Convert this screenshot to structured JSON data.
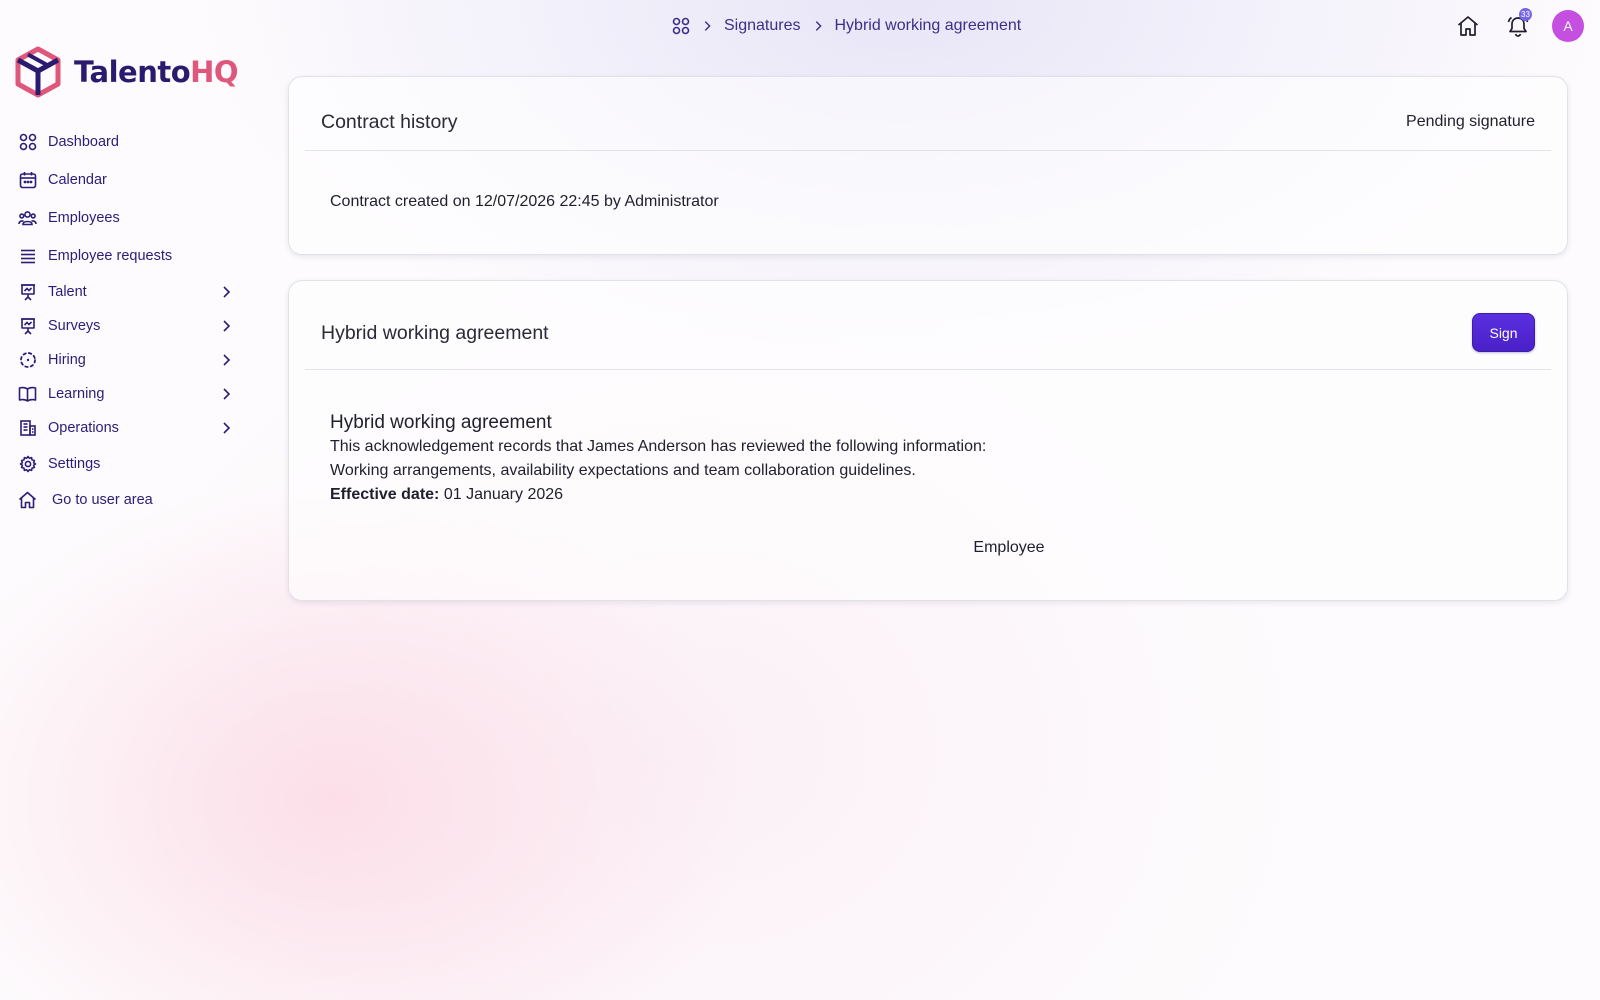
{
  "app": {
    "logo_part1": "Talento",
    "logo_part2": "HQ",
    "brand_colors": {
      "primary": "#2a1b6e",
      "accent": "#e0577c",
      "button": "#4f25d4"
    }
  },
  "breadcrumb": {
    "home_icon": "grid-icon",
    "items": [
      "Signatures",
      "Hybrid working agreement"
    ]
  },
  "topbar": {
    "notifications_count": "33",
    "avatar_initial": "A"
  },
  "sidebar": {
    "items": [
      {
        "label": "Dashboard",
        "icon": "grid-icon",
        "expandable": false
      },
      {
        "label": "Calendar",
        "icon": "calendar-icon",
        "expandable": false
      },
      {
        "label": "Employees",
        "icon": "users-icon",
        "expandable": false
      },
      {
        "label": "Employee requests",
        "icon": "list-icon",
        "expandable": false
      },
      {
        "label": "Talent",
        "icon": "presentation-icon",
        "expandable": true
      },
      {
        "label": "Surveys",
        "icon": "presentation-icon",
        "expandable": true
      },
      {
        "label": "Hiring",
        "icon": "dashed-circle-icon",
        "expandable": true
      },
      {
        "label": "Learning",
        "icon": "book-icon",
        "expandable": true
      },
      {
        "label": "Operations",
        "icon": "building-icon",
        "expandable": true
      },
      {
        "label": "Settings",
        "icon": "gear-icon",
        "expandable": false
      },
      {
        "label": "Go to user area",
        "icon": "home-icon",
        "expandable": false
      }
    ]
  },
  "history_card": {
    "title": "Contract history",
    "status": "Pending signature",
    "entry": "Contract created on 12/07/2026 22:45 by Administrator"
  },
  "document_card": {
    "title": "Hybrid working agreement",
    "sign_label": "Sign",
    "doc_title": "Hybrid working agreement",
    "line1": "This acknowledgement records that James Anderson has reviewed the following information:",
    "line2": "Working arrangements, availability expectations and team collaboration guidelines.",
    "effective_label": "Effective date:",
    "effective_value": "01 January 2026",
    "signer_label": "Employee"
  }
}
